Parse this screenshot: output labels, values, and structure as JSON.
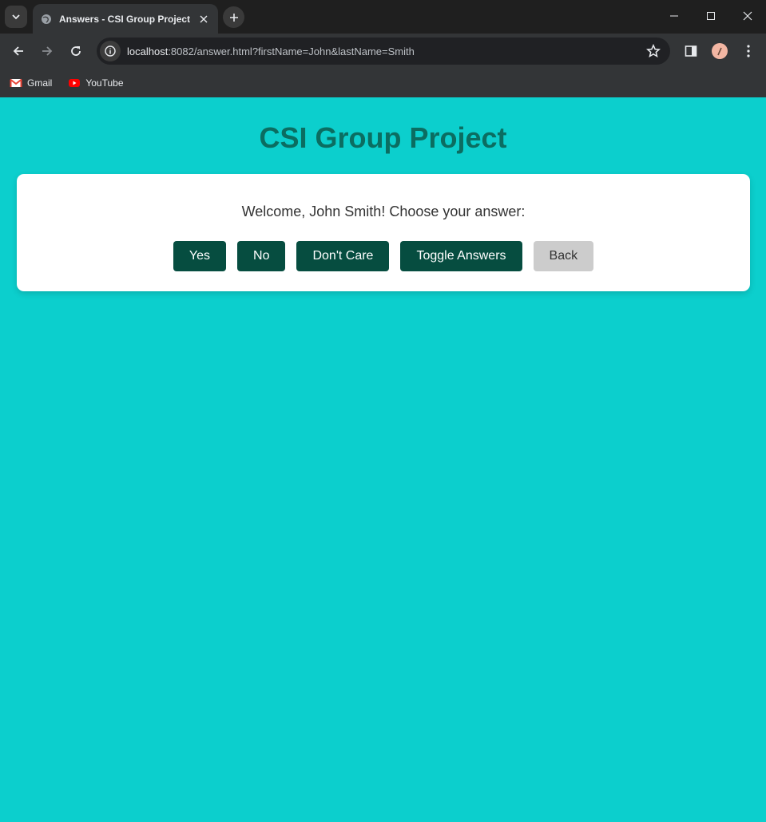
{
  "browser": {
    "tab_title": "Answers - CSI Group Project",
    "url_host": "localhost",
    "url_rest": ":8082/answer.html?firstName=John&lastName=Smith",
    "bookmarks": [
      {
        "label": "Gmail",
        "icon": "gmail-icon"
      },
      {
        "label": "YouTube",
        "icon": "youtube-icon"
      }
    ]
  },
  "page": {
    "title": "CSI Group Project",
    "welcome": "Welcome, John Smith! Choose your answer:",
    "buttons": {
      "yes": "Yes",
      "no": "No",
      "dont_care": "Don't Care",
      "toggle": "Toggle Answers",
      "back": "Back"
    }
  },
  "colors": {
    "page_bg": "#0ccfcd",
    "title": "#0b6d61",
    "primary_button": "#064d40",
    "back_button": "#cccccc"
  }
}
